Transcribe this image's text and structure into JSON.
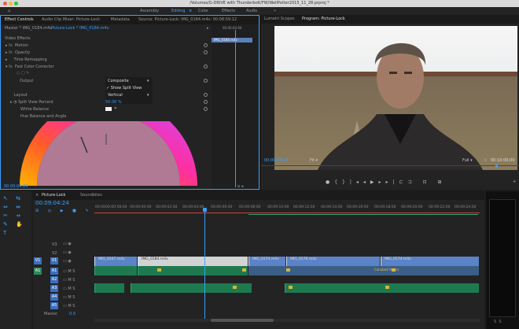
{
  "titlebar": {
    "text": "/Volumes/G-DRIVE with Thunderbolt/FW/WellPotter2015_11_28.prproj *"
  },
  "workspaces": [
    "Assembly",
    "Editing",
    "Color",
    "Effects",
    "Audio"
  ],
  "workspace_active": "Editing",
  "workspace_more": "»",
  "source_tabs": [
    "Effect Controls",
    "Audio Clip Mixer: Picture-Lock",
    "Metadata",
    "Source: Picture-Lock: IMG_0184.m4v: 00:08:59:12"
  ],
  "effect_controls": {
    "master_label": "Master * IMG_0184.m4v",
    "sequence_label": "Picture-Lock * IMG_0184.m4v",
    "mini_time": "00:00:04:00",
    "mini_clip": "IMG_0184.m4v",
    "section_title": "Video Effects",
    "effects": [
      "Motion",
      "Opacity",
      "Time Remapping",
      "Fast Color Corrector"
    ],
    "output_label": "Output",
    "output_value": "Composite",
    "show_split_view": "✓ Show Split View",
    "layout_label": "Layout",
    "layout_value": "Vertical",
    "split_label": "Split View Percent",
    "split_value": "50.00 %",
    "white_balance_label": "White Balance",
    "hue_label": "Hue Balance and Angle",
    "timecode": "00:00:04:24"
  },
  "program": {
    "tabs": [
      "Lumetri Scopes",
      "Program: Picture-Lock"
    ],
    "timecode": "00:00:04:24",
    "fit": "Fit",
    "quality": "Full",
    "duration": "00:10:00:00"
  },
  "timeline": {
    "tabs": [
      "Picture-Lock",
      "Soundbites"
    ],
    "timecode": "00:09:04:24",
    "ruler": [
      "00:00",
      "00:00:58:00",
      "00:09:00:00",
      "00:09:02:00",
      "00:09:04:00",
      "00:09:06:00",
      "00:09:08:00",
      "00:09:10:00",
      "00:09:12:00",
      "00:09:14:00",
      "00:09:16:00",
      "00:09:18:00",
      "00:09:20:00",
      "00:09:22:00",
      "00:09:24:00"
    ],
    "tracks": [
      "V3",
      "V2",
      "V1",
      "A1",
      "A2",
      "A3",
      "A4",
      "A5"
    ],
    "source_patch": [
      "V1",
      "A1"
    ],
    "master_label": "Master",
    "master_value": "0.0",
    "clips": [
      "IMG_0167.m4v",
      "IMG_0184.m4v",
      "IMG_0174.m4v",
      "IMG_0176.m4v",
      "IMG_0174.m4v"
    ],
    "audio_label": "Constant Power"
  },
  "colors": {
    "accent": "#3aa0ff",
    "video_clip": "#5a83c8",
    "audio_clip": "#1e7a4e"
  }
}
